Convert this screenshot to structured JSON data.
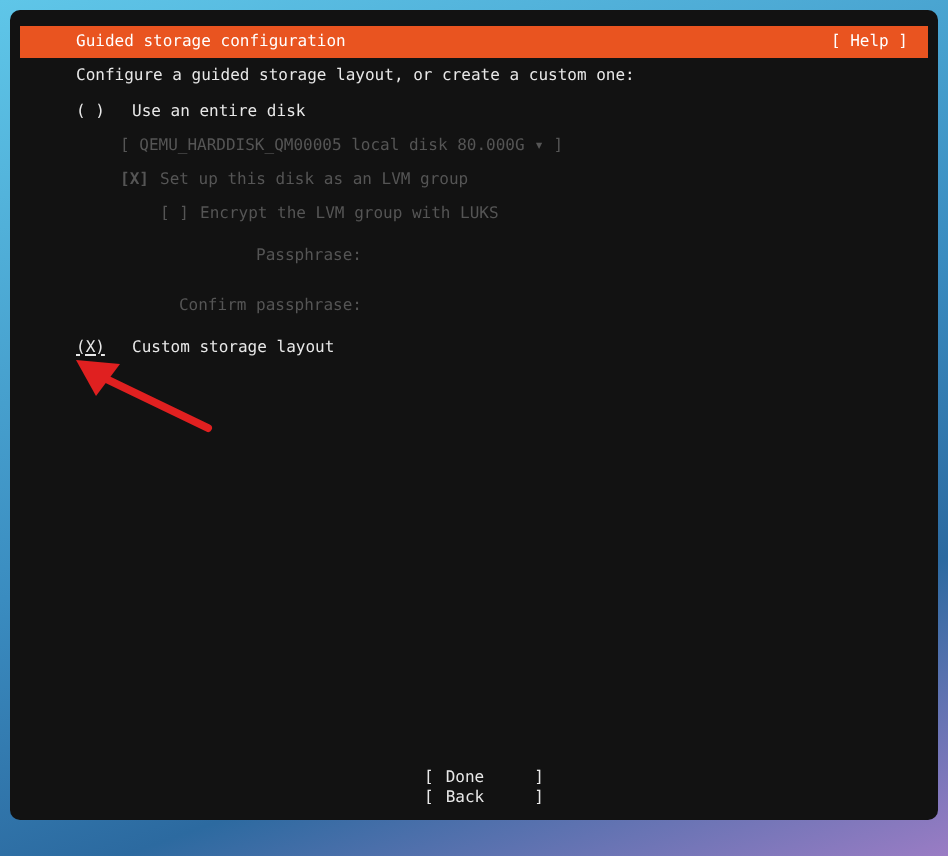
{
  "window": {
    "title": "Guided storage configuration",
    "help": "[ Help ]"
  },
  "intro": "Configure a guided storage layout, or create a custom one:",
  "options": [
    {
      "kind": "radio",
      "mark": "( )",
      "label": "Use an entire disk",
      "selected": false
    },
    {
      "kind": "dropdown",
      "label": "[ QEMU_HARDDISK_QM00005 local disk 80.000G ▾ ]",
      "disabled": true
    },
    {
      "kind": "checkbox",
      "mark": "[X]",
      "label": "Set up this disk as an LVM group",
      "checked": true,
      "disabled": true
    },
    {
      "kind": "subcheckbox",
      "mark": "[ ]",
      "label": "Encrypt the LVM group with LUKS",
      "checked": false,
      "disabled": true
    },
    {
      "kind": "field",
      "label": "Passphrase:",
      "disabled": true
    },
    {
      "kind": "field",
      "label": "Confirm passphrase:",
      "disabled": true
    },
    {
      "kind": "radio",
      "mark": "(X)",
      "label": "Custom storage layout",
      "selected": true
    }
  ],
  "buttons": [
    {
      "open": "[",
      "label": "Done",
      "close": "]"
    },
    {
      "open": "[",
      "label": "Back",
      "close": "]"
    }
  ]
}
